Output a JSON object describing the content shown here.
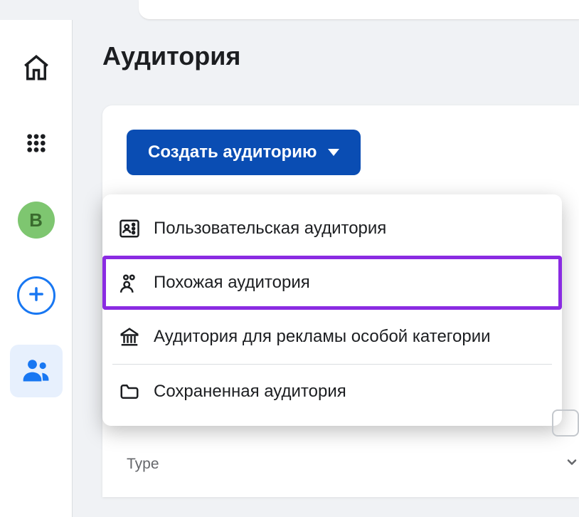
{
  "page": {
    "title": "Аудитория"
  },
  "sidebar": {
    "avatar_letter": "B"
  },
  "create_button": {
    "label": "Создать аудиторию"
  },
  "dropdown": {
    "items": [
      {
        "label": "Пользовательская аудитория",
        "icon": "user-box-icon"
      },
      {
        "label": "Похожая аудитория",
        "icon": "lookalike-icon",
        "highlighted": true
      },
      {
        "label": "Аудитория для рекламы особой категории",
        "icon": "bank-icon"
      },
      {
        "label": "Сохраненная аудитория",
        "icon": "folder-icon"
      }
    ]
  },
  "filters": {
    "type_label": "Type"
  }
}
